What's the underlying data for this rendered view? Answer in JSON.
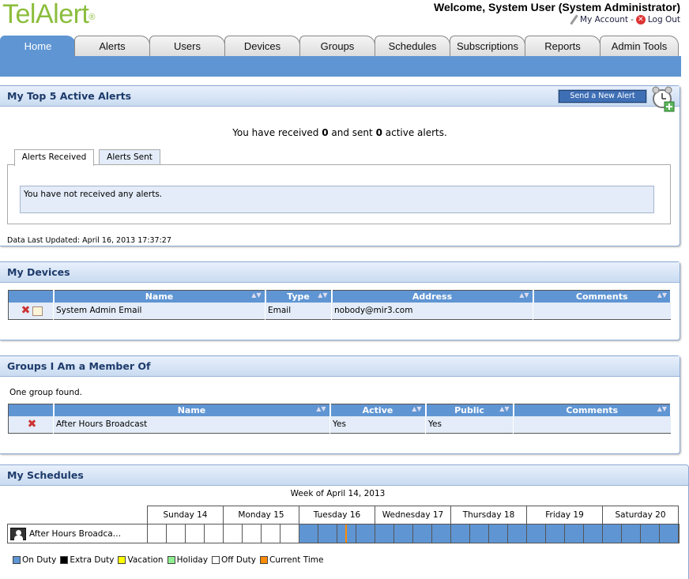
{
  "brand": {
    "name": "TelAlert",
    "trademark": "®"
  },
  "header": {
    "welcome": "Welcome, System User (System Administrator)",
    "my_account": "My Account",
    "separator": "-",
    "logout": "Log Out"
  },
  "tabs": [
    {
      "label": "Home",
      "active": true
    },
    {
      "label": "Alerts"
    },
    {
      "label": "Users"
    },
    {
      "label": "Devices"
    },
    {
      "label": "Groups"
    },
    {
      "label": "Schedules"
    },
    {
      "label": "Subscriptions"
    },
    {
      "label": "Reports"
    },
    {
      "label": "Admin Tools"
    }
  ],
  "alerts": {
    "title": "My Top 5 Active Alerts",
    "send_button": "Send a New Alert",
    "summary_pre": "You have received ",
    "received": "0",
    "summary_mid": " and sent ",
    "sent": "0",
    "summary_post": " active alerts.",
    "tab_received": "Alerts Received",
    "tab_sent": "Alerts Sent",
    "empty_message": "You have not received any alerts.",
    "last_updated": "Data Last Updated: April 16, 2013 17:37:27"
  },
  "devices": {
    "title": "My Devices",
    "columns": [
      "Name",
      "Type",
      "Address",
      "Comments"
    ],
    "rows": [
      {
        "name": "System Admin Email",
        "type": "Email",
        "address": "nobody@mir3.com",
        "comments": ""
      }
    ]
  },
  "groups": {
    "title": "Groups I Am a Member Of",
    "count_text": "One group found.",
    "columns": [
      "Name",
      "Active",
      "Public",
      "Comments"
    ],
    "rows": [
      {
        "name": "After Hours Broadcast",
        "active": "Yes",
        "public": "Yes",
        "comments": ""
      }
    ]
  },
  "schedules": {
    "title": "My Schedules",
    "week": "Week of April 14, 2013",
    "days": [
      "Sunday 14",
      "Monday 15",
      "Tuesday 16",
      "Wednesday 17",
      "Thursday 18",
      "Friday 19",
      "Saturday 20"
    ],
    "row_label": "After Hours Broadca…",
    "legend": [
      {
        "label": "On Duty",
        "color": "#5f95d3"
      },
      {
        "label": "Extra Duty",
        "color": "#000000"
      },
      {
        "label": "Vacation",
        "color": "#ffff00"
      },
      {
        "label": "Holiday",
        "color": "#90ee90"
      },
      {
        "label": "Off Duty",
        "color": "#ffffff"
      },
      {
        "label": "Current Time",
        "color": "#ff8c00"
      }
    ],
    "on_duty_color": "#5f95d3",
    "current_time_color": "#ff8c00"
  }
}
